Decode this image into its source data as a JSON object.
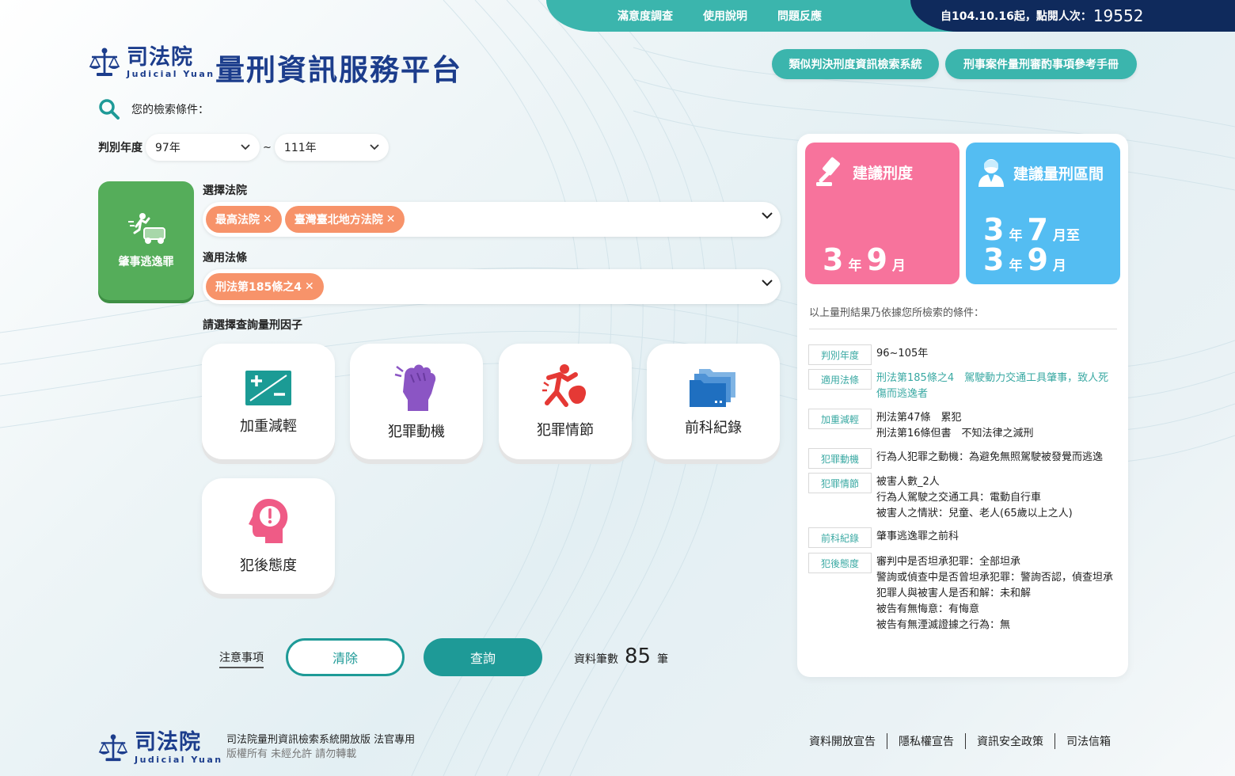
{
  "topbar": {
    "links": [
      "滿意度調查",
      "使用說明",
      "問題反應"
    ],
    "visit_label": "自104.10.16起，點閱人次：",
    "visit_count": "19552"
  },
  "header": {
    "brand_zh": "司法院",
    "brand_en": "Judicial Yuan",
    "site_title": "量刑資訊服務平台",
    "btn_similar": "類似判決刑度資訊檢索系統",
    "btn_manual": "刑事案件量刑審酌事項參考手冊"
  },
  "search": {
    "label": "您的檢索條件：",
    "year_label": "判別年度",
    "year_from": "97年",
    "year_to": "111年",
    "tilde": "~"
  },
  "crime": {
    "label": "肇事逃逸罪"
  },
  "court": {
    "label": "選擇法院",
    "tags": [
      "最高法院",
      "臺灣臺北地方法院"
    ]
  },
  "law": {
    "label": "適用法條",
    "tags": [
      "刑法第185條之4"
    ]
  },
  "factors": {
    "label": "請選擇查詢量刑因子",
    "items": [
      "加重減輕",
      "犯罪動機",
      "犯罪情節",
      "前科紀錄",
      "犯後態度"
    ]
  },
  "actions": {
    "notice": "注意事項",
    "clear": "清除",
    "query": "查詢",
    "records_label": "資料筆數",
    "records_count": "85",
    "records_unit": "筆"
  },
  "result": {
    "suggest_title": "建議刑度",
    "suggest_years": "3",
    "suggest_months": "9",
    "range_title": "建議量刑區間",
    "range_from_years": "3",
    "range_from_months": "7",
    "range_to_years": "3",
    "range_to_months": "9",
    "unit_year": "年",
    "unit_month": "月",
    "unit_month_to": "月至",
    "basis": "以上量刑結果乃依據您所檢索的條件：",
    "criteria": [
      {
        "key": "判別年度",
        "lines": [
          "96~105年"
        ]
      },
      {
        "key": "適用法條",
        "lines": [
          "刑法第185條之4　駕駛動力交通工具肇事，致人死傷而逃逸者"
        ]
      },
      {
        "key": "加重減輕",
        "lines": [
          "刑法第47條　累犯",
          "刑法第16條但書　不知法律之減刑"
        ]
      },
      {
        "key": "犯罪動機",
        "lines": [
          "行為人犯罪之動機：為避免無照駕駛被發覺而逃逸"
        ]
      },
      {
        "key": "犯罪情節",
        "lines": [
          "被害人數_2人",
          "行為人駕駛之交通工具：電動自行車",
          "被害人之情狀：兒童、老人(65歲以上之人)"
        ]
      },
      {
        "key": "前科紀錄",
        "lines": [
          "肇事逃逸罪之前科"
        ]
      },
      {
        "key": "犯後態度",
        "lines": [
          "審判中是否坦承犯罪：全部坦承",
          "警詢或偵查中是否曾坦承犯罪：警詢否認，偵查坦承",
          "犯罪人與被害人是否和解：未和解",
          "被告有無悔意：有悔意",
          "被告有無湮滅證據之行為：無"
        ]
      }
    ]
  },
  "footer": {
    "brand_zh": "司法院",
    "brand_en": "Judicial Yuan",
    "line1": "司法院量刑資訊檢索系統開放版 法官專用",
    "line2": "版權所有 未經允許 請勿轉載",
    "links": [
      "資料開放宣告",
      "隱私權宣告",
      "資訊安全政策",
      "司法信箱"
    ]
  },
  "colors": {
    "teal": "#3bb5ad",
    "navy": "#0f2a5c",
    "brand_blue": "#1c3d8c",
    "orange_tag": "#f7936a",
    "green_card": "#55ad5a",
    "pink": "#f7739c",
    "sky": "#54bdf2",
    "query_btn": "#1e9a97"
  }
}
